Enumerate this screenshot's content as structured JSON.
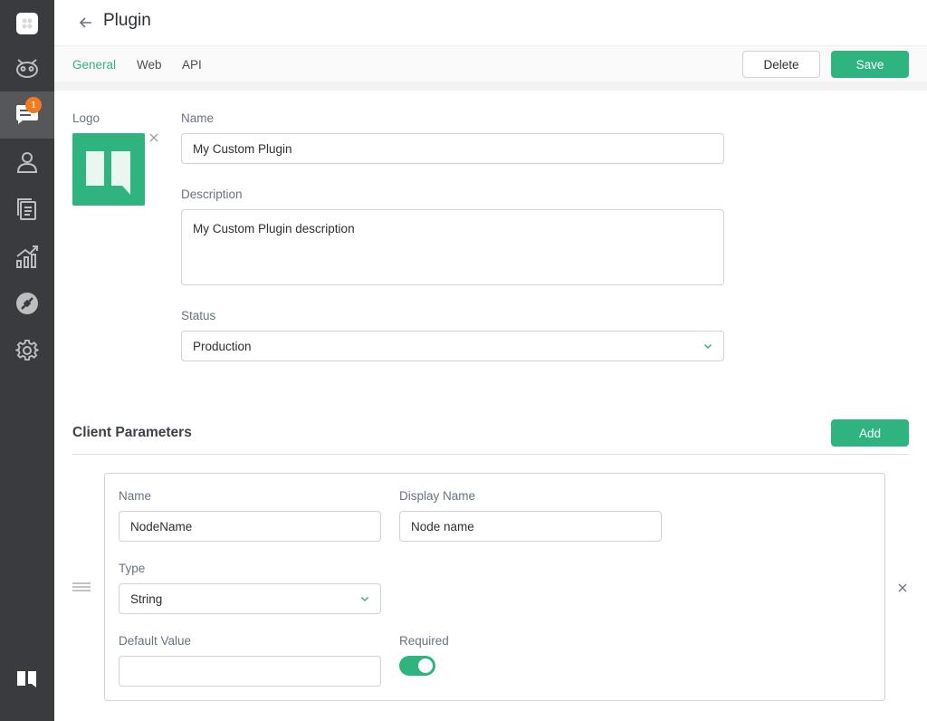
{
  "header": {
    "title": "Plugin"
  },
  "tabs": [
    {
      "label": "General",
      "active": true
    },
    {
      "label": "Web",
      "active": false
    },
    {
      "label": "API",
      "active": false
    }
  ],
  "actions": {
    "delete_label": "Delete",
    "save_label": "Save"
  },
  "sidebar": {
    "badge_count": "1",
    "items": [
      {
        "icon": "app-logo-icon"
      },
      {
        "icon": "bot-icon"
      },
      {
        "icon": "chat-icon",
        "active": true
      },
      {
        "icon": "user-icon"
      },
      {
        "icon": "documents-icon"
      },
      {
        "icon": "analytics-icon"
      },
      {
        "icon": "integrations-icon"
      },
      {
        "icon": "gear-icon"
      },
      {
        "icon": "brand-logo-icon"
      }
    ]
  },
  "form": {
    "logo_label": "Logo",
    "name_label": "Name",
    "name_value": "My Custom Plugin",
    "description_label": "Description",
    "description_value": "My Custom Plugin description",
    "status_label": "Status",
    "status_value": "Production"
  },
  "client_params": {
    "title": "Client Parameters",
    "add_label": "Add",
    "items": [
      {
        "name_label": "Name",
        "name_value": "NodeName",
        "display_name_label": "Display Name",
        "display_name_value": "Node name",
        "type_label": "Type",
        "type_value": "String",
        "default_value_label": "Default Value",
        "default_value": "",
        "required_label": "Required",
        "required": true
      }
    ]
  },
  "colors": {
    "accent": "#2fb47f",
    "sidebar": "#3a3b3e",
    "badge": "#f07c1e"
  }
}
